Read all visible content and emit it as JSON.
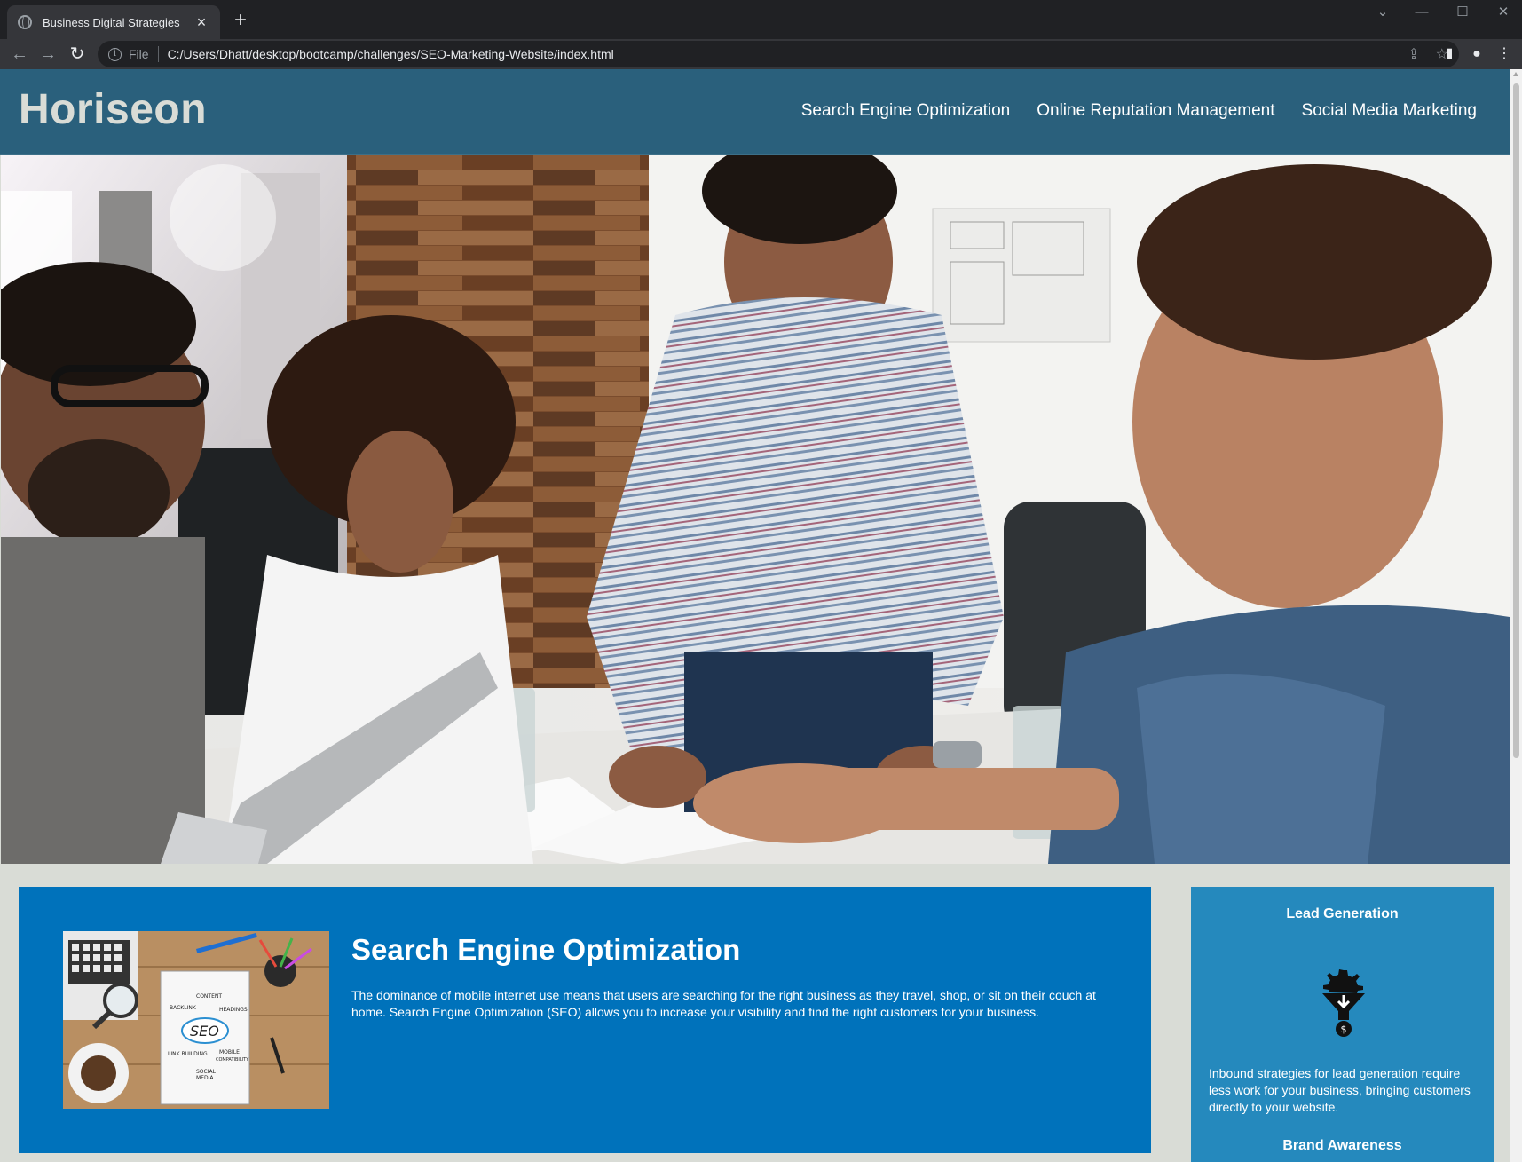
{
  "browser": {
    "tab_title": "Business Digital Strategies",
    "new_tab": "+",
    "tab_close": "×",
    "omnibox": {
      "security_label": "File",
      "url": "C:/Users/Dhatt/desktop/bootcamp/challenges/SEO-Marketing-Website/index.html"
    },
    "icons": [
      "globe-icon",
      "back-icon",
      "forward-icon",
      "reload-icon",
      "info-icon",
      "share-icon",
      "star-icon",
      "side-panel-icon",
      "profile-icon",
      "menu-icon"
    ]
  },
  "site": {
    "logo": "Horiseon",
    "nav": [
      "Search Engine Optimization",
      "Online Reputation Management",
      "Social Media Marketing"
    ],
    "hero_alt": "Business team meeting"
  },
  "content": {
    "seo": {
      "title": "Search Engine Optimization",
      "text": "The dominance of mobile internet use means that users are searching for the right business as they travel, shop, or sit on their couch at home. Search Engine Optimization (SEO) allows you to increase your visibility and find the right customers for your business.",
      "image_words": [
        "CONTENT",
        "BACKLINK",
        "HEADINGS",
        "SEO",
        "LINK BUILDING",
        "MOBILE COMPATIBILITY",
        "SOCIAL MEDIA"
      ]
    }
  },
  "benefits": {
    "lead": {
      "title": "Lead Generation",
      "text": "Inbound strategies for lead generation require less work for your business, bringing customers directly to your website."
    },
    "next_title": "Brand Awareness"
  },
  "colors": {
    "header_bg": "#2a607c",
    "page_bg": "#d9dcd6",
    "content_bg": "#0072bb",
    "benefit_bg": "#2589bd"
  }
}
